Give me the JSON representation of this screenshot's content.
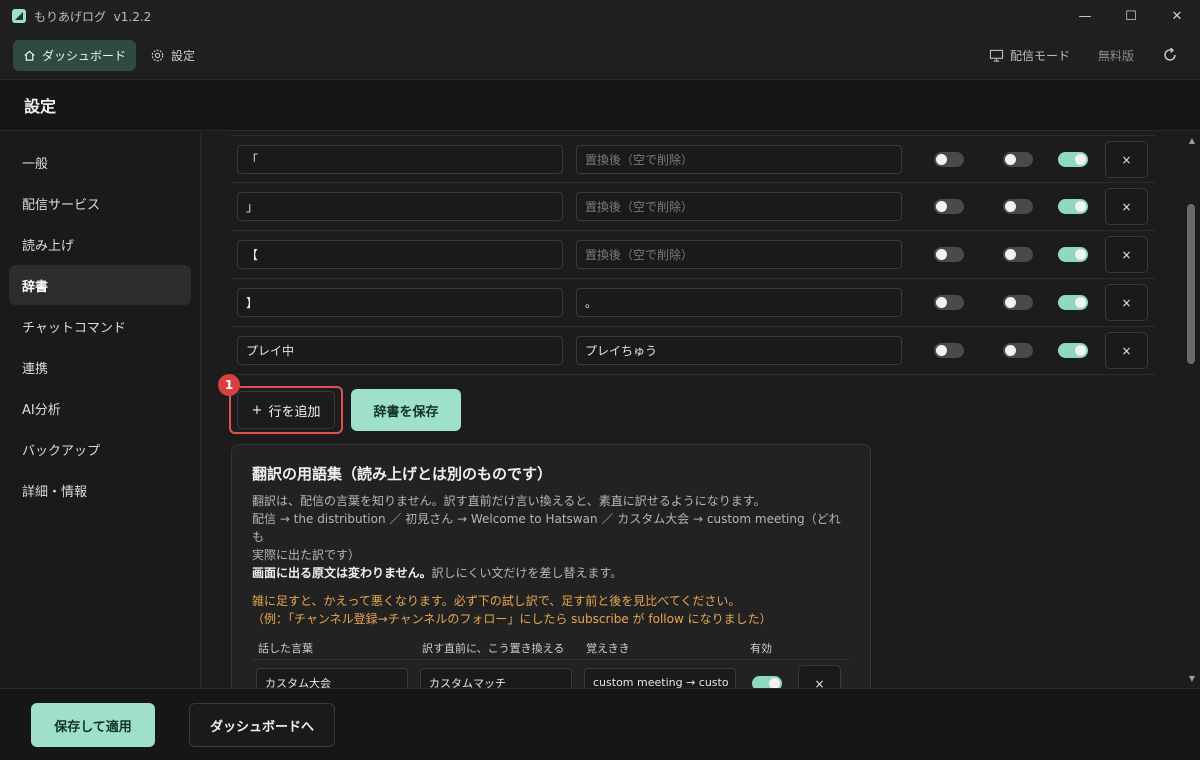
{
  "window": {
    "title": "もりあげログ",
    "version": "v1.2.2",
    "controls": {
      "minimize": "—",
      "maximize": "☐",
      "close": "✕"
    }
  },
  "topnav": {
    "dashboard": "ダッシュボード",
    "settings": "設定",
    "delivery_mode": "配信モード",
    "plan": "無料版"
  },
  "page": {
    "title": "設定"
  },
  "sidebar": {
    "items": [
      {
        "label": "一般"
      },
      {
        "label": "配信サービス"
      },
      {
        "label": "読み上げ"
      },
      {
        "label": "辞書",
        "active": true
      },
      {
        "label": "チャットコマンド"
      },
      {
        "label": "連携"
      },
      {
        "label": "AI分析"
      },
      {
        "label": "バックアップ"
      },
      {
        "label": "詳細・情報"
      }
    ]
  },
  "dictionary": {
    "rows": [
      {
        "source": "「",
        "replacement": "",
        "placeholder": "置換後（空で削除）",
        "toggle1": false,
        "toggle2": false,
        "toggle3": true,
        "delete": "×"
      },
      {
        "source": "」",
        "replacement": "",
        "placeholder": "置換後（空で削除）",
        "toggle1": false,
        "toggle2": false,
        "toggle3": true,
        "delete": "×"
      },
      {
        "source": "【",
        "replacement": "",
        "placeholder": "置換後（空で削除）",
        "toggle1": false,
        "toggle2": false,
        "toggle3": true,
        "delete": "×"
      },
      {
        "source": "】",
        "replacement": "。",
        "placeholder": "置換後（空で削除）",
        "toggle1": false,
        "toggle2": false,
        "toggle3": true,
        "delete": "×"
      },
      {
        "source": "プレイ中",
        "replacement": "プレイちゅう",
        "placeholder": "置換後（空で削除）",
        "toggle1": false,
        "toggle2": false,
        "toggle3": true,
        "delete": "×"
      }
    ],
    "add_row_label": "行を追加",
    "add_row_icon": "+",
    "badge": "1",
    "save_label": "辞書を保存"
  },
  "glossary": {
    "title": "翻訳の用語集（読み上げとは別のものです）",
    "desc_line1": "翻訳は、配信の言葉を知りません。訳す直前だけ言い換えると、素直に訳せるようになります。",
    "desc_line2": "配信 → the distribution ／ 初見さん → Welcome to Hatswan ／ カスタム大会 → custom meeting（どれも",
    "desc_line3": "実際に出た訳です）",
    "desc_strong": "画面に出る原文は変わりません。",
    "desc_line4": "訳しにくい文だけを差し替えます。",
    "warn_line1": "雑に足すと、かえって悪くなります。必ず下の試し訳で、足す前と後を見比べてください。",
    "warn_line2": "（例：「チャンネル登録→チャンネルのフォロー」にしたら subscribe が follow になりました）",
    "columns": {
      "spoken": "話した言葉",
      "replace": "訳す直前に、こう置き換える",
      "memo": "覚えきき",
      "enabled": "有効"
    },
    "rows": [
      {
        "spoken": "カスタム大会",
        "replace": "カスタムマッチ",
        "memo": "custom meeting → custo",
        "enabled": true,
        "delete": "×"
      }
    ]
  },
  "footer": {
    "save_apply": "保存して適用",
    "to_dashboard": "ダッシュボードへ"
  },
  "colors": {
    "accent": "#9ee0cc",
    "warning": "#e9a64e",
    "highlight": "#e0524f"
  }
}
